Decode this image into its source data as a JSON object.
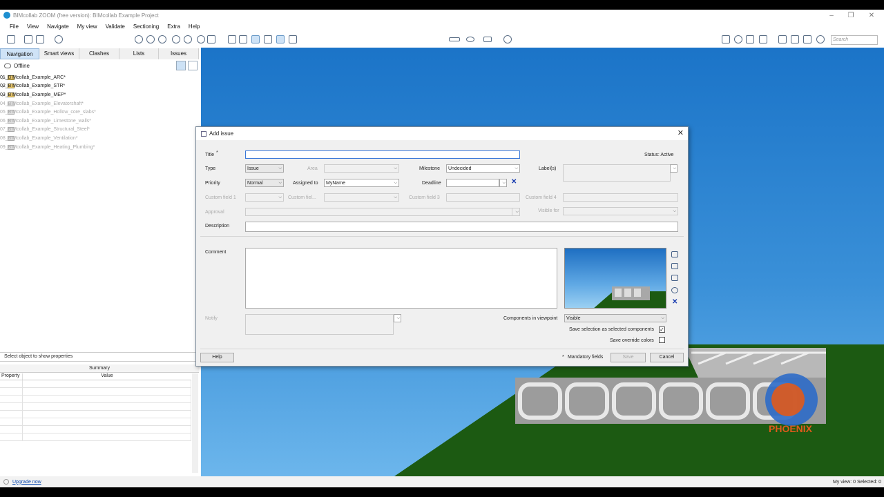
{
  "app": {
    "title": "BIMcollab ZOOM (free version): BIMcollab Example Project"
  },
  "menu": [
    "File",
    "View",
    "Navigate",
    "My view",
    "Validate",
    "Sectioning",
    "Extra",
    "Help"
  ],
  "search": {
    "placeholder": "Search"
  },
  "tabs": [
    "Navigation",
    "Smart views",
    "Clashes",
    "Lists",
    "Issues"
  ],
  "active_tab": "Navigation",
  "offline_label": "Offline",
  "tree": [
    {
      "label": "01_BIMcollab_Example_ARC*",
      "enabled": true
    },
    {
      "label": "02_BIMcollab_Example_STR*",
      "enabled": true
    },
    {
      "label": "03_BIMcollab_Example_MEP*",
      "enabled": true
    },
    {
      "label": "04_BIMcollab_Example_Elevatorshaft*",
      "enabled": false
    },
    {
      "label": "05_BIMcollab_Example_Hollow_core_slabs*",
      "enabled": false
    },
    {
      "label": "06_BIMcollab_Example_Limestone_walls*",
      "enabled": false
    },
    {
      "label": "07_BIMcollab_Example_Structural_Steel*",
      "enabled": false
    },
    {
      "label": "08_BIMcollab_Example_Ventilation*",
      "enabled": false
    },
    {
      "label": "09_BIMcollab_Example_Heating_Plumbing*",
      "enabled": false
    }
  ],
  "properties": {
    "select_hint": "Select object to show properties",
    "summary": "Summary",
    "col_property": "Property",
    "col_value": "Value"
  },
  "statusbar": {
    "upgrade": "Upgrade now",
    "myview": "My view: 0",
    "selected": "Selected: 0"
  },
  "watermark": "PHOENIX",
  "dialog": {
    "title": "Add issue",
    "status": "Status: Active",
    "labels": {
      "title": "Title",
      "type": "Type",
      "area": "Area",
      "milestone": "Milestone",
      "labels": "Label(s)",
      "priority": "Priority",
      "assigned_to": "Assigned to",
      "deadline": "Deadline",
      "custom1": "Custom field 1",
      "custom2": "Custom fiel...",
      "custom3": "Custom field 3",
      "custom4": "Custom field 4",
      "approval": "Approval",
      "visible_for": "Visible for",
      "description": "Description",
      "comment": "Comment",
      "notify": "Notify",
      "components_in_viewpoint": "Components in viewpoint",
      "save_selection": "Save selection as selected components",
      "save_override": "Save override colors",
      "mandatory": "Mandatory fields"
    },
    "values": {
      "title": "",
      "type": "Issue",
      "milestone": "Undecided",
      "priority": "Normal",
      "assigned_to": "MyName",
      "deadline": "",
      "components_in_viewpoint": "Visible"
    },
    "checks": {
      "save_selection": true,
      "save_override": false
    },
    "buttons": {
      "help": "Help",
      "save": "Save",
      "cancel": "Cancel"
    }
  }
}
